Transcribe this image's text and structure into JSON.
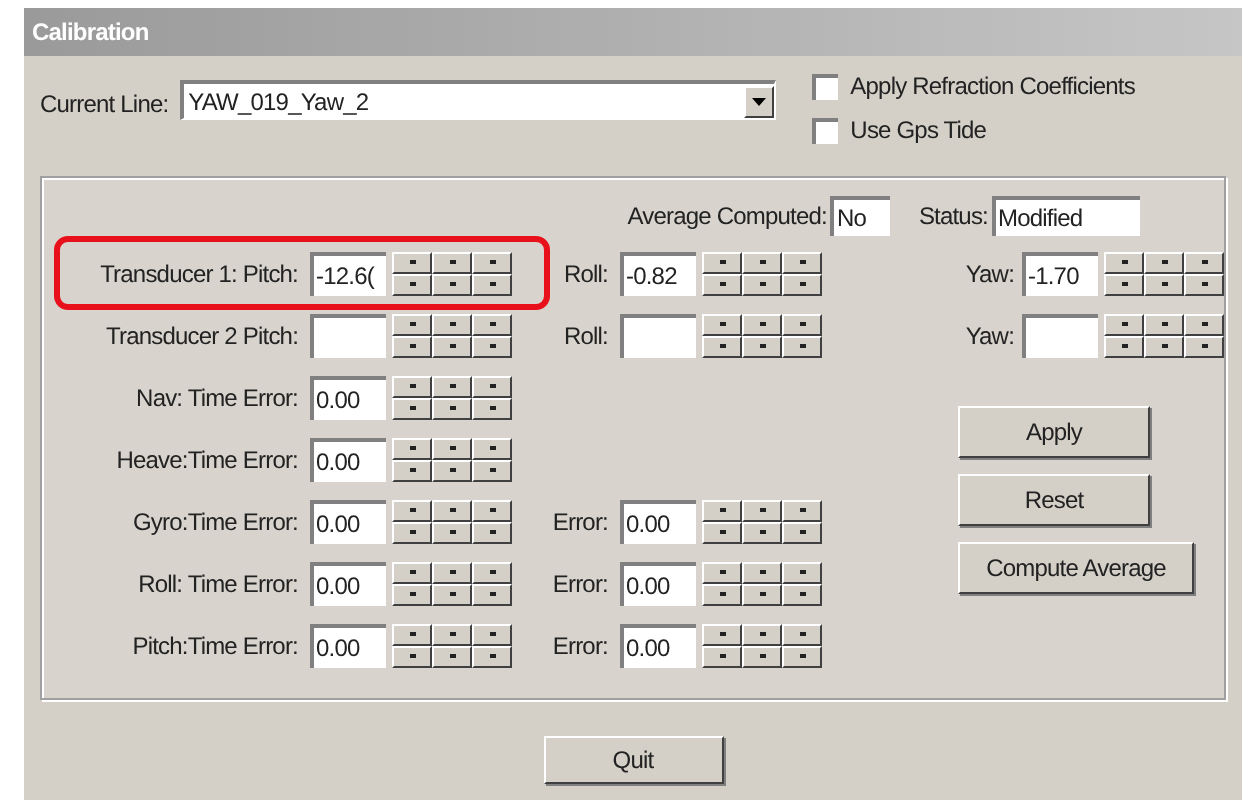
{
  "window": {
    "title": "Calibration"
  },
  "current_line": {
    "label": "Current Line:",
    "value": "YAW_019_Yaw_2"
  },
  "options": [
    {
      "label": "Apply Refraction Coefficients",
      "checked": false
    },
    {
      "label": "Use Gps Tide",
      "checked": false
    }
  ],
  "average_computed": {
    "label": "Average Computed:",
    "value": "No"
  },
  "status": {
    "label": "Status:",
    "value": "Modified"
  },
  "left_rows": [
    {
      "label": "Transducer 1: Pitch:",
      "value": "-12.6(",
      "highlighted": true
    },
    {
      "label": "Transducer 2 Pitch:",
      "highlighted": false
    },
    {
      "label": "Nav: Time Error:",
      "value": "0.00",
      "highlighted": false
    },
    {
      "label": "Heave:Time Error:",
      "value": "0.00",
      "highlighted": false
    },
    {
      "label": "Gyro:Time Error:",
      "value": "0.00",
      "highlighted": false
    },
    {
      "label": "Roll: Time Error:",
      "value": "0.00",
      "highlighted": false
    },
    {
      "label": "Pitch:Time Error:",
      "value": "0.00",
      "highlighted": false
    }
  ],
  "roll_rows": [
    {
      "label": "Roll:",
      "value": "-0.82"
    },
    {
      "label": "Roll:"
    }
  ],
  "error_rows": [
    {
      "label": "Error:",
      "value": "0.00"
    },
    {
      "label": "Error:",
      "value": "0.00"
    },
    {
      "label": "Error:",
      "value": "0.00"
    }
  ],
  "yaw_rows": [
    {
      "label": "Yaw:",
      "value": "-1.70"
    },
    {
      "label": "Yaw:"
    }
  ],
  "buttons": [
    "Apply",
    "Reset",
    "Compute Average"
  ],
  "quit_button": "Quit"
}
